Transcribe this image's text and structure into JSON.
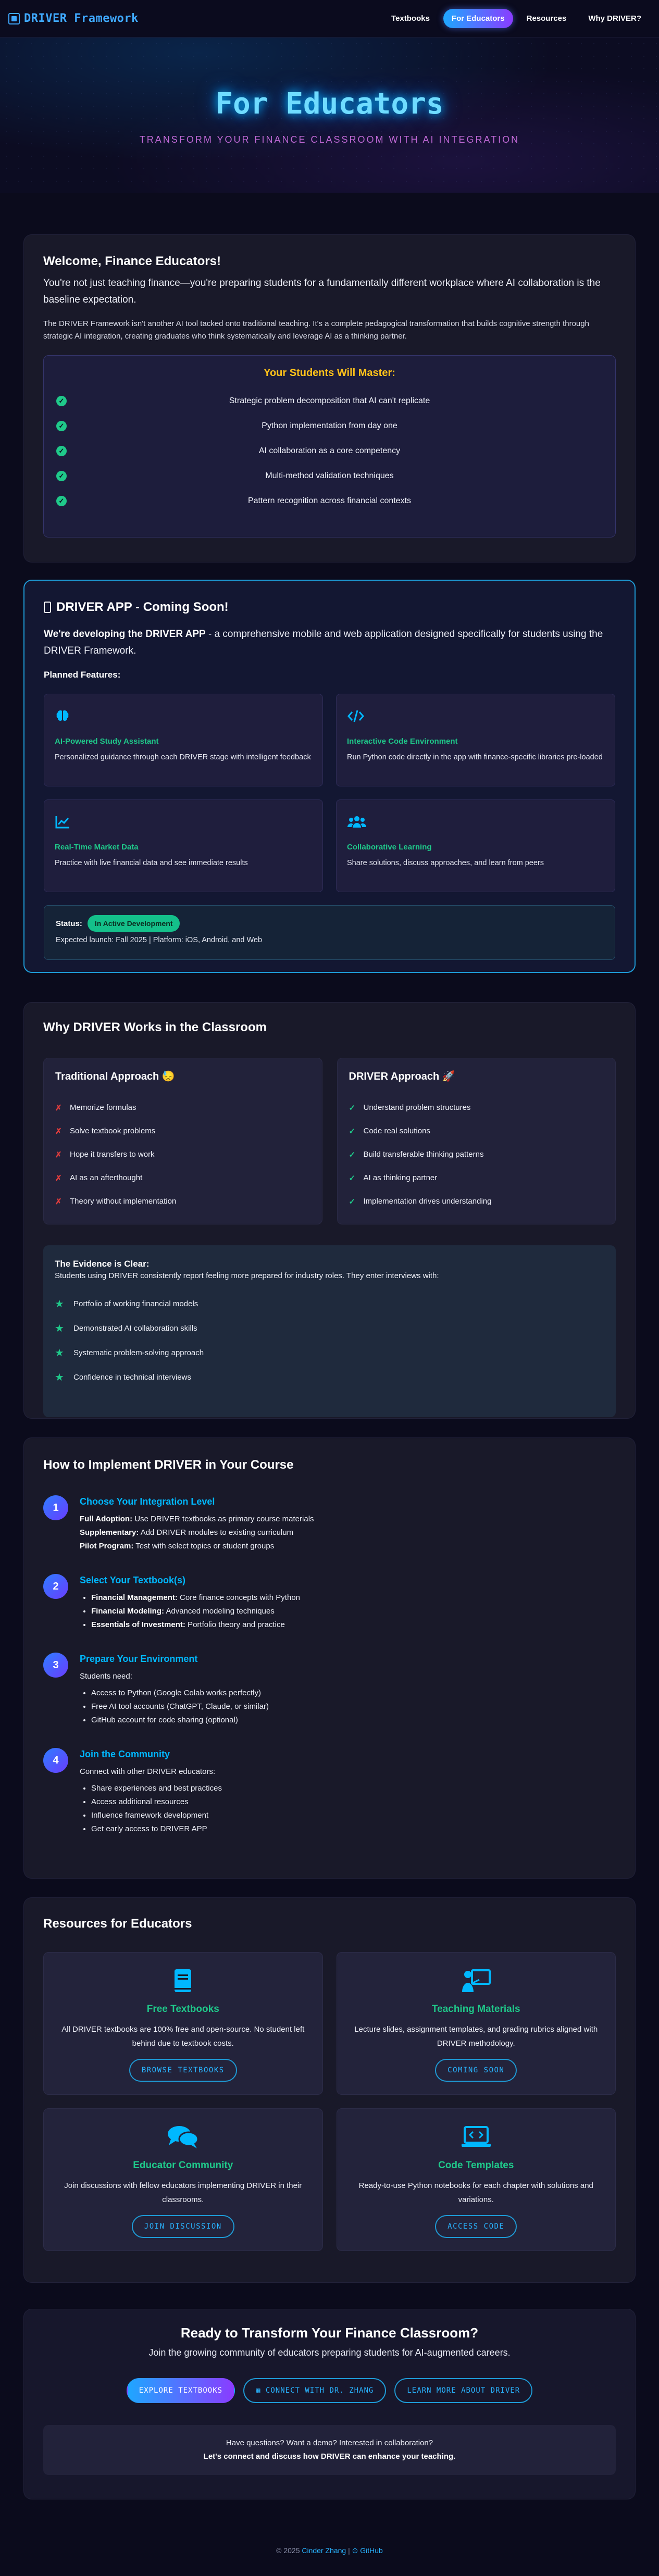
{
  "nav": {
    "brand": "DRIVER Framework",
    "links": [
      "Textbooks",
      "For Educators",
      "Resources",
      "Why DRIVER?"
    ]
  },
  "hero": {
    "title": "For Educators",
    "subtitle": "Transform Your Finance Classroom with AI Integration"
  },
  "welcome": {
    "title": "Welcome, Finance Educators!",
    "lead": "You're not just teaching finance—you're preparing students for a fundamentally different workplace where AI collaboration is the baseline expectation.",
    "body": "The DRIVER Framework isn't another AI tool tacked onto traditional teaching. It's a complete pedagogical transformation that builds cognitive strength through strategic AI integration, creating graduates who think systematically and leverage AI as a thinking partner.",
    "master_title": "Your Students Will Master:",
    "master_items": [
      "Strategic problem decomposition that AI can't replicate",
      "Python implementation from day one",
      "AI collaboration as a core competency",
      "Multi-method validation techniques",
      "Pattern recognition across financial contexts"
    ]
  },
  "app": {
    "title": "DRIVER APP - Coming Soon!",
    "lead_bold": "We're developing the DRIVER APP",
    "lead_rest": " - a comprehensive mobile and web application designed specifically for students using the DRIVER Framework.",
    "planned": "Planned Features:",
    "features": [
      {
        "icon": "brain-icon",
        "title": "AI-Powered Study Assistant",
        "desc": "Personalized guidance through each DRIVER stage with intelligent feedback"
      },
      {
        "icon": "code-icon",
        "title": "Interactive Code Environment",
        "desc": "Run Python code directly in the app with finance-specific libraries pre-loaded"
      },
      {
        "icon": "chart-line-icon",
        "title": "Real-Time Market Data",
        "desc": "Practice with live financial data and see immediate results"
      },
      {
        "icon": "users-icon",
        "title": "Collaborative Learning",
        "desc": "Share solutions, discuss approaches, and learn from peers"
      }
    ],
    "status_label": "Status:",
    "status_badge": "In Active Development",
    "expected": "Expected launch: Fall 2025 | Platform: iOS, Android, and Web"
  },
  "why": {
    "title": "Why DRIVER Works in the Classroom",
    "traditional_title": "Traditional Approach 😓",
    "traditional_items": [
      "Memorize formulas",
      "Solve textbook problems",
      "Hope it transfers to work",
      "AI as an afterthought",
      "Theory without implementation"
    ],
    "driver_title": "DRIVER Approach 🚀",
    "driver_items": [
      "Understand problem structures",
      "Code real solutions",
      "Build transferable thinking patterns",
      "AI as thinking partner",
      "Implementation drives understanding"
    ],
    "evidence_title": "The Evidence is Clear:",
    "evidence_text": "Students using DRIVER consistently report feeling more prepared for industry roles. They enter interviews with:",
    "evidence_items": [
      "Portfolio of working financial models",
      "Demonstrated AI collaboration skills",
      "Systematic problem-solving approach",
      "Confidence in technical interviews"
    ]
  },
  "how": {
    "title": "How to Implement DRIVER in Your Course",
    "steps": [
      {
        "num": "1",
        "title": "Choose Your Integration Level"
      },
      {
        "num": "2",
        "title": "Select Your Textbook(s)"
      },
      {
        "num": "3",
        "title": "Prepare Your Environment"
      },
      {
        "num": "4",
        "title": "Join the Community"
      }
    ],
    "s1": [
      {
        "b": "Full Adoption:",
        "t": " Use DRIVER textbooks as primary course materials"
      },
      {
        "b": "Supplementary:",
        "t": " Add DRIVER modules to existing curriculum"
      },
      {
        "b": "Pilot Program:",
        "t": " Test with select topics or student groups"
      }
    ],
    "s2": [
      {
        "b": "Financial Management:",
        "t": " Core finance concepts with Python"
      },
      {
        "b": "Financial Modeling:",
        "t": " Advanced modeling techniques"
      },
      {
        "b": "Essentials of Investment:",
        "t": " Portfolio theory and practice"
      }
    ],
    "s3_intro": "Students need:",
    "s3": [
      "Access to Python (Google Colab works perfectly)",
      "Free AI tool accounts (ChatGPT, Claude, or similar)",
      "GitHub account for code sharing (optional)"
    ],
    "s4_intro": "Connect with other DRIVER educators:",
    "s4": [
      "Share experiences and best practices",
      "Access additional resources",
      "Influence framework development",
      "Get early access to DRIVER APP"
    ]
  },
  "resources": {
    "title": "Resources for Educators",
    "cards": [
      {
        "icon": "book-icon",
        "title": "Free Textbooks",
        "desc": "All DRIVER textbooks are 100% free and open-source. No student left behind due to textbook costs.",
        "btn": "BROWSE TEXTBOOKS"
      },
      {
        "icon": "presentation-icon",
        "title": "Teaching Materials",
        "desc": "Lecture slides, assignment templates, and grading rubrics aligned with DRIVER methodology.",
        "btn": "COMING SOON"
      },
      {
        "icon": "comments-icon",
        "title": "Educator Community",
        "desc": "Join discussions with fellow educators implementing DRIVER in their classrooms.",
        "btn": "JOIN DISCUSSION"
      },
      {
        "icon": "laptop-code-icon",
        "title": "Code Templates",
        "desc": "Ready-to-use Python notebooks for each chapter with solutions and variations.",
        "btn": "ACCESS CODE"
      }
    ]
  },
  "cta": {
    "title": "Ready to Transform Your Finance Classroom?",
    "subtitle": "Join the growing community of educators preparing students for AI-augmented careers.",
    "btn_explore": "EXPLORE TEXTBOOKS",
    "btn_connect": "CONNECT WITH DR. ZHANG",
    "btn_learn": "LEARN MORE ABOUT DRIVER",
    "note_line1": "Have questions? Want a demo? Interested in collaboration?",
    "note_line2": "Let's connect and discuss how DRIVER can enhance your teaching."
  },
  "footer": {
    "prefix": "© 2025",
    "author": "Cinder Zhang",
    "sep": "|",
    "github": "GitHub"
  },
  "colors": {
    "accent_blue": "#00b8ff",
    "accent_green": "#1fc98a",
    "accent_yellow": "#ffc21a",
    "accent_red": "#e23d3d",
    "accent_purple": "#8a3cff"
  }
}
